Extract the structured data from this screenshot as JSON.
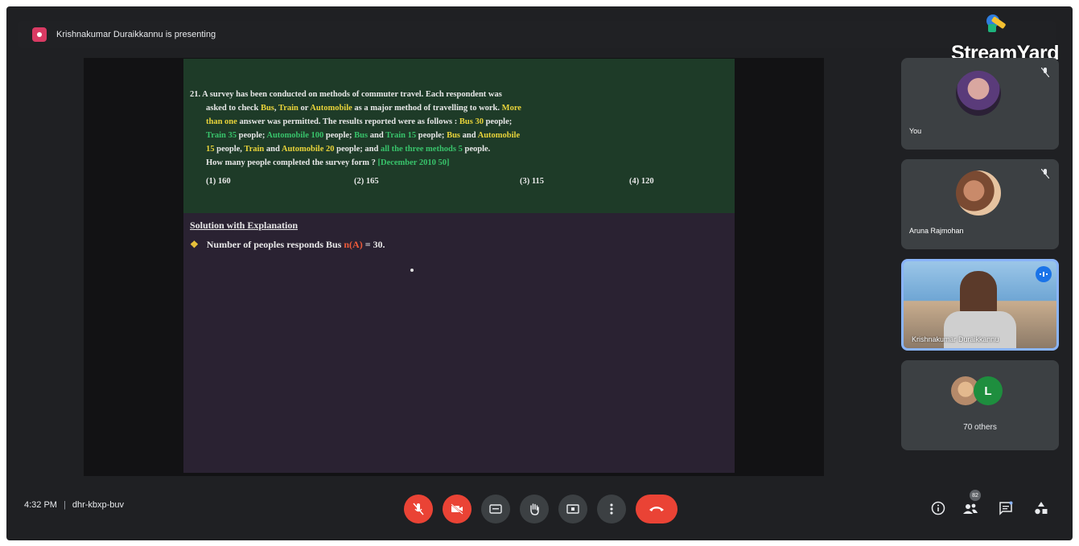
{
  "presenter_bar": {
    "text": "Krishnakumar Duraikkannu is presenting"
  },
  "branding": {
    "logo_text": "StreamYard"
  },
  "slide": {
    "question_lines": [
      {
        "parts": [
          [
            "w",
            "21. A survey has been conducted on methods of commuter travel. Each respondent was"
          ]
        ]
      },
      {
        "parts": [
          [
            "w",
            "asked to check "
          ],
          [
            "y",
            "Bus"
          ],
          [
            "w",
            ", "
          ],
          [
            "y",
            "Train"
          ],
          [
            "w",
            " or "
          ],
          [
            "y",
            "Automobile"
          ],
          [
            "w",
            " as a major method of travelling to work. "
          ],
          [
            "y",
            "More"
          ]
        ]
      },
      {
        "parts": [
          [
            "y",
            "than one"
          ],
          [
            "w",
            " answer was permitted. The results reported were as follows : "
          ],
          [
            "y",
            "Bus 30"
          ],
          [
            "w",
            " people;"
          ]
        ]
      },
      {
        "parts": [
          [
            "g",
            "Train 35"
          ],
          [
            "w",
            " people; "
          ],
          [
            "g",
            "Automobile 100"
          ],
          [
            "w",
            " people; "
          ],
          [
            "g",
            "Bus"
          ],
          [
            "w",
            " and "
          ],
          [
            "g",
            "Train 15"
          ],
          [
            "w",
            " people; "
          ],
          [
            "y",
            "Bus"
          ],
          [
            "w",
            " and "
          ],
          [
            "y",
            "Automobile"
          ]
        ]
      },
      {
        "parts": [
          [
            "y",
            "15"
          ],
          [
            "w",
            " people, "
          ],
          [
            "y",
            "Train"
          ],
          [
            "w",
            " and "
          ],
          [
            "y",
            "Automobile 20"
          ],
          [
            "w",
            " people; and "
          ],
          [
            "g",
            "all the three methods 5"
          ],
          [
            "w",
            " people."
          ]
        ]
      },
      {
        "parts": [
          [
            "w",
            "How many people completed the survey form ?    "
          ],
          [
            "g",
            "[December 2010 50]"
          ]
        ]
      }
    ],
    "options": [
      "(1) 160",
      "(2) 165",
      "(3) 115",
      "(4) 120"
    ],
    "solution_title": "Solution with Explanation",
    "solution_line_prefix": "Number of peoples responds Bus ",
    "solution_line_highlight": "n(A)",
    "solution_line_suffix": " = 30."
  },
  "participants": [
    {
      "name": "You"
    },
    {
      "name": "Aruna Rajmohan"
    },
    {
      "name": "Krishnakumar Duraikkannu"
    },
    {
      "name": "70 others",
      "avatar_letter": "L"
    }
  ],
  "toolbar": {
    "time": "4:32 PM",
    "separator": "|",
    "meeting_code": "dhr-kbxp-buv",
    "people_badge": "82"
  },
  "colors": {
    "accent_red": "#ea4335",
    "question_bg": "#1e3b28",
    "slide_bg": "#2a2232",
    "highlight_yellow": "#e8d33a",
    "highlight_green": "#38c36b",
    "tile_bg": "#3c4043",
    "active_speaker": "#8ab4f8"
  }
}
